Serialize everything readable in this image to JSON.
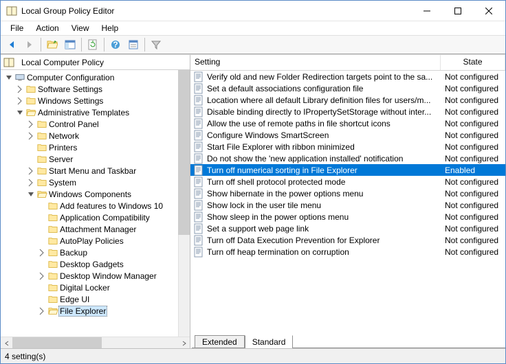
{
  "window": {
    "title": "Local Group Policy Editor"
  },
  "menu": {
    "file": "File",
    "action": "Action",
    "view": "View",
    "help": "Help"
  },
  "tree_header": "Local Computer Policy",
  "tree": {
    "root": "Computer Configuration",
    "n_software": "Software Settings",
    "n_windows": "Windows Settings",
    "n_admin": "Administrative Templates",
    "n_cp": "Control Panel",
    "n_net": "Network",
    "n_print": "Printers",
    "n_srv": "Server",
    "n_smt": "Start Menu and Taskbar",
    "n_sys": "System",
    "n_wc": "Windows Components",
    "wc_add": "Add features to Windows 10",
    "wc_appcompat": "Application Compatibility",
    "wc_attach": "Attachment Manager",
    "wc_autoplay": "AutoPlay Policies",
    "wc_backup": "Backup",
    "wc_gadgets": "Desktop Gadgets",
    "wc_dwm": "Desktop Window Manager",
    "wc_locker": "Digital Locker",
    "wc_edge": "Edge UI",
    "wc_fe": "File Explorer"
  },
  "columns": {
    "setting": "Setting",
    "state": "State"
  },
  "settings": [
    {
      "name": "Verify old and new Folder Redirection targets point to the sa...",
      "state": "Not configured"
    },
    {
      "name": "Set a default associations configuration file",
      "state": "Not configured"
    },
    {
      "name": "Location where all default Library definition files for users/m...",
      "state": "Not configured"
    },
    {
      "name": "Disable binding directly to IPropertySetStorage without inter...",
      "state": "Not configured"
    },
    {
      "name": "Allow the use of remote paths in file shortcut icons",
      "state": "Not configured"
    },
    {
      "name": "Configure Windows SmartScreen",
      "state": "Not configured"
    },
    {
      "name": "Start File Explorer with ribbon minimized",
      "state": "Not configured"
    },
    {
      "name": "Do not show the 'new application installed' notification",
      "state": "Not configured"
    },
    {
      "name": "Turn off numerical sorting in File Explorer",
      "state": "Enabled",
      "selected": true
    },
    {
      "name": "Turn off shell protocol protected mode",
      "state": "Not configured"
    },
    {
      "name": "Show hibernate in the power options menu",
      "state": "Not configured"
    },
    {
      "name": "Show lock in the user tile menu",
      "state": "Not configured"
    },
    {
      "name": "Show sleep in the power options menu",
      "state": "Not configured"
    },
    {
      "name": "Set a support web page link",
      "state": "Not configured"
    },
    {
      "name": "Turn off Data Execution Prevention for Explorer",
      "state": "Not configured"
    },
    {
      "name": "Turn off heap termination on corruption",
      "state": "Not configured"
    }
  ],
  "tabs": {
    "extended": "Extended",
    "standard": "Standard"
  },
  "status": "4 setting(s)"
}
